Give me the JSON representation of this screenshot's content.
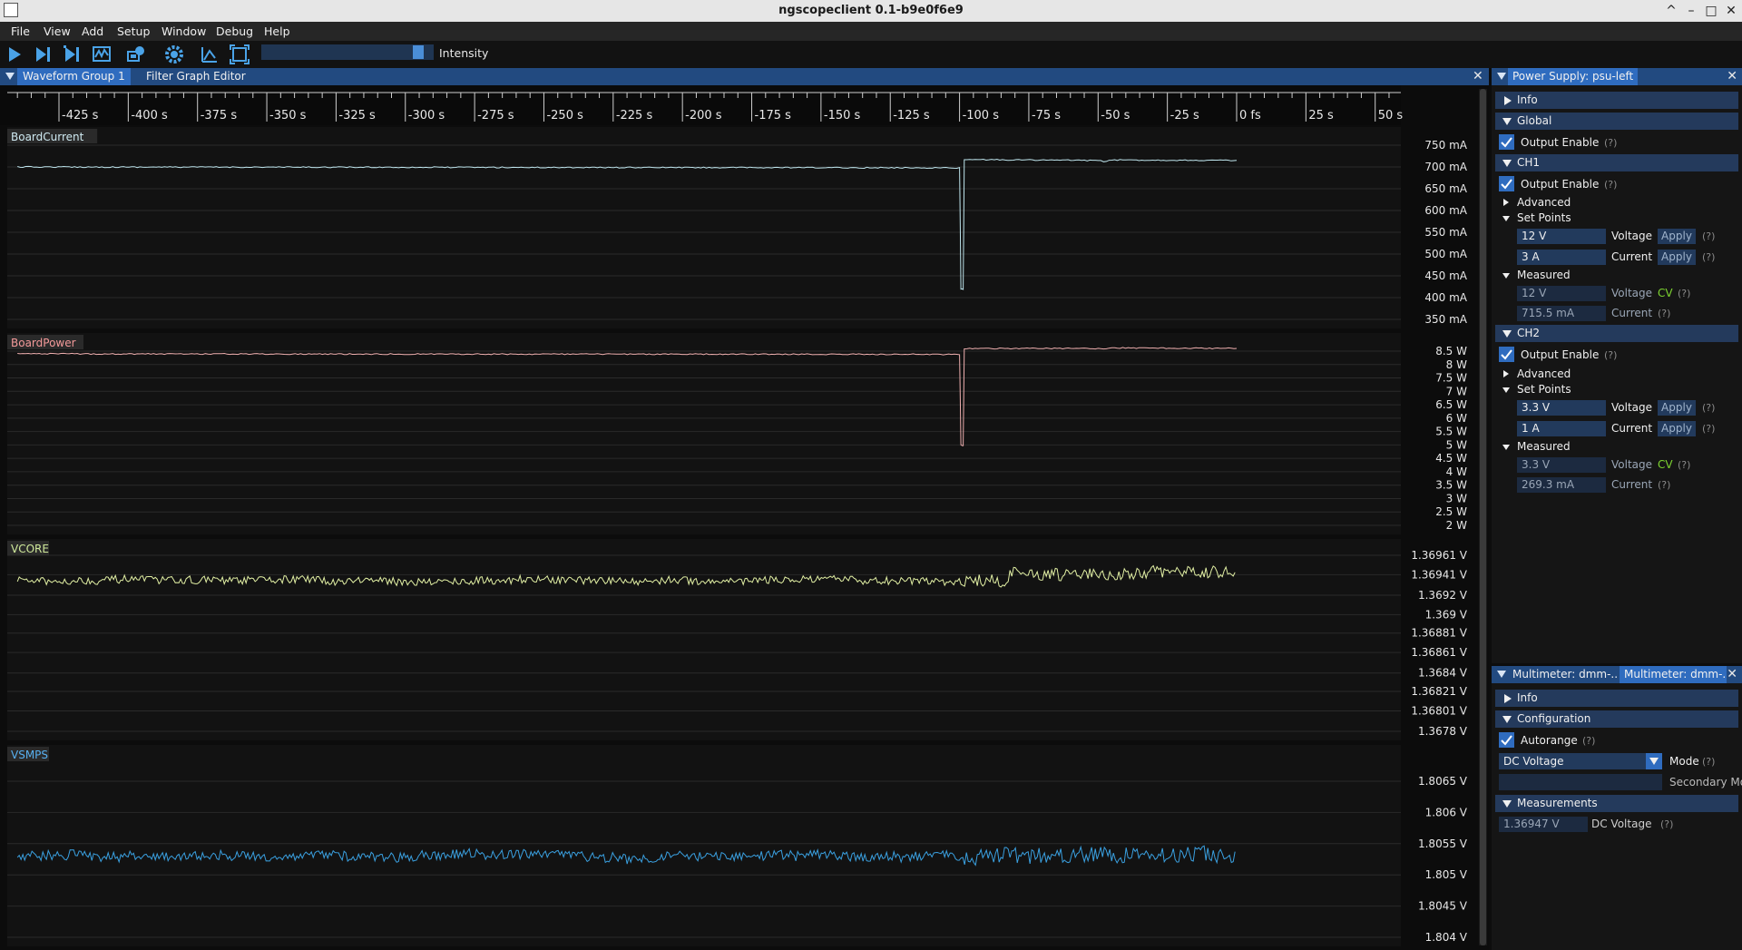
{
  "window": {
    "title": "ngscopeclient 0.1-b9e0f6e9",
    "buttons": [
      "^",
      "–",
      "□",
      "✕"
    ]
  },
  "menu": [
    "File",
    "View",
    "Add",
    "Setup",
    "Window",
    "Debug",
    "Help"
  ],
  "toolbar": {
    "icons": [
      "run-icon",
      "single-trigger-icon",
      "force-trigger-icon",
      "waveform-icon",
      "connect-icon",
      "settings-icon",
      "measure-icon",
      "fullscreen-icon"
    ],
    "intensity_label": "Intensity",
    "intensity_value": 0.94
  },
  "waveform_group": {
    "tabs": [
      "Waveform Group 1",
      "Filter Graph Editor"
    ],
    "close": "✕",
    "timeline": {
      "labels": [
        "-425 s",
        "-400 s",
        "-375 s",
        "-350 s",
        "-325 s",
        "-300 s",
        "-275 s",
        "-250 s",
        "-225 s",
        "-200 s",
        "-175 s",
        "-150 s",
        "-125 s",
        "-100 s",
        "-75 s",
        "-50 s",
        "-25 s",
        "0 fs",
        "25 s",
        "50 s"
      ],
      "values": [
        -425,
        -400,
        -375,
        -350,
        -325,
        -300,
        -275,
        -250,
        -225,
        -200,
        -175,
        -150,
        -125,
        -100,
        -75,
        -50,
        -25,
        0,
        25,
        50
      ],
      "unit": "s"
    },
    "plots": [
      {
        "name": "BoardCurrent",
        "color": "#bfe6ee",
        "label_color": "#cfeaf2",
        "y_labels": [
          "750 mA",
          "700 mA",
          "650 mA",
          "600 mA",
          "550 mA",
          "500 mA",
          "450 mA",
          "400 mA",
          "350 mA"
        ],
        "y_values": [
          750,
          700,
          650,
          600,
          550,
          500,
          450,
          400,
          350
        ],
        "unit": "mA",
        "trace": [
          [
            -440,
            700
          ],
          [
            -100,
            698
          ],
          [
            -99.5,
            420
          ],
          [
            -98.7,
            418
          ],
          [
            -98.3,
            717
          ],
          [
            -50,
            715
          ],
          [
            -48,
            712
          ],
          [
            -45,
            716
          ],
          [
            0,
            715
          ]
        ]
      },
      {
        "name": "BoardPower",
        "color": "#f0b0b0",
        "label_color": "#f49a9a",
        "y_labels": [
          "8.5 W",
          "8 W",
          "7.5 W",
          "7 W",
          "6.5 W",
          "6 W",
          "5.5 W",
          "5 W",
          "4.5 W",
          "4 W",
          "3.5 W",
          "3 W",
          "2.5 W",
          "2 W"
        ],
        "y_values": [
          8.5,
          8,
          7.5,
          7,
          6.5,
          6,
          5.5,
          5,
          4.5,
          4,
          3.5,
          3,
          2.5,
          2
        ],
        "unit": "W",
        "trace": [
          [
            -440,
            8.4
          ],
          [
            -100,
            8.38
          ],
          [
            -99.5,
            5.0
          ],
          [
            -98.7,
            4.98
          ],
          [
            -98.3,
            8.6
          ],
          [
            -50,
            8.6
          ],
          [
            -48,
            8.58
          ],
          [
            -45,
            8.62
          ],
          [
            0,
            8.6
          ]
        ]
      },
      {
        "name": "VCORE",
        "color": "#e2f0a4",
        "label_color": "#cfe89a",
        "y_labels": [
          "1.36961 V",
          "1.36941 V",
          "1.3692 V",
          "1.369 V",
          "1.36881 V",
          "1.36861 V",
          "1.3684 V",
          "1.36821 V",
          "1.36801 V",
          "1.3678 V"
        ],
        "y_values": [
          1.36961,
          1.36941,
          1.3692,
          1.369,
          1.36881,
          1.36861,
          1.3684,
          1.36821,
          1.36801,
          1.3678
        ],
        "unit": "V",
        "trace_center": 1.36935,
        "trace_noise": 8e-05
      },
      {
        "name": "VSMPS",
        "color": "#3aa0e0",
        "label_color": "#58b0f0",
        "y_labels": [
          "1.8065 V",
          "1.806 V",
          "1.8055 V",
          "1.805 V",
          "1.8045 V",
          "1.804 V"
        ],
        "y_values": [
          1.8065,
          1.806,
          1.8055,
          1.805,
          1.8045,
          1.804
        ],
        "unit": "V",
        "trace_center": 1.8053,
        "trace_noise": 0.00016
      }
    ]
  },
  "psu_panel": {
    "tab": "Power Supply: psu-left",
    "close": "✕",
    "info_label": "Info",
    "global_label": "Global",
    "output_enable": "Output Enable",
    "help": "(?)",
    "channels": [
      {
        "name": "CH1",
        "advanced": "Advanced",
        "set_points": "Set Points",
        "voltage_set": "12 V",
        "current_set": "3 A",
        "measured": "Measured",
        "voltage_meas": "12 V",
        "current_meas": "715.5 mA",
        "mode": "CV"
      },
      {
        "name": "CH2",
        "advanced": "Advanced",
        "set_points": "Set Points",
        "voltage_set": "3.3 V",
        "current_set": "1 A",
        "measured": "Measured",
        "voltage_meas": "3.3 V",
        "current_meas": "269.3 mA",
        "mode": "CV"
      }
    ],
    "voltage_label": "Voltage",
    "current_label": "Current",
    "apply_label": "Apply"
  },
  "dmm_panel": {
    "tabs": [
      "Multimeter: dmm-...",
      "Multimeter: dmm-..."
    ],
    "close": "✕",
    "info_label": "Info",
    "config_label": "Configuration",
    "autorange_label": "Autorange",
    "help": "(?)",
    "mode_value": "DC Voltage",
    "mode_label": "Mode",
    "secondary_label": "Secondary Mo",
    "measurements_label": "Measurements",
    "reading": "1.36947 V",
    "reading_label": "DC Voltage"
  }
}
